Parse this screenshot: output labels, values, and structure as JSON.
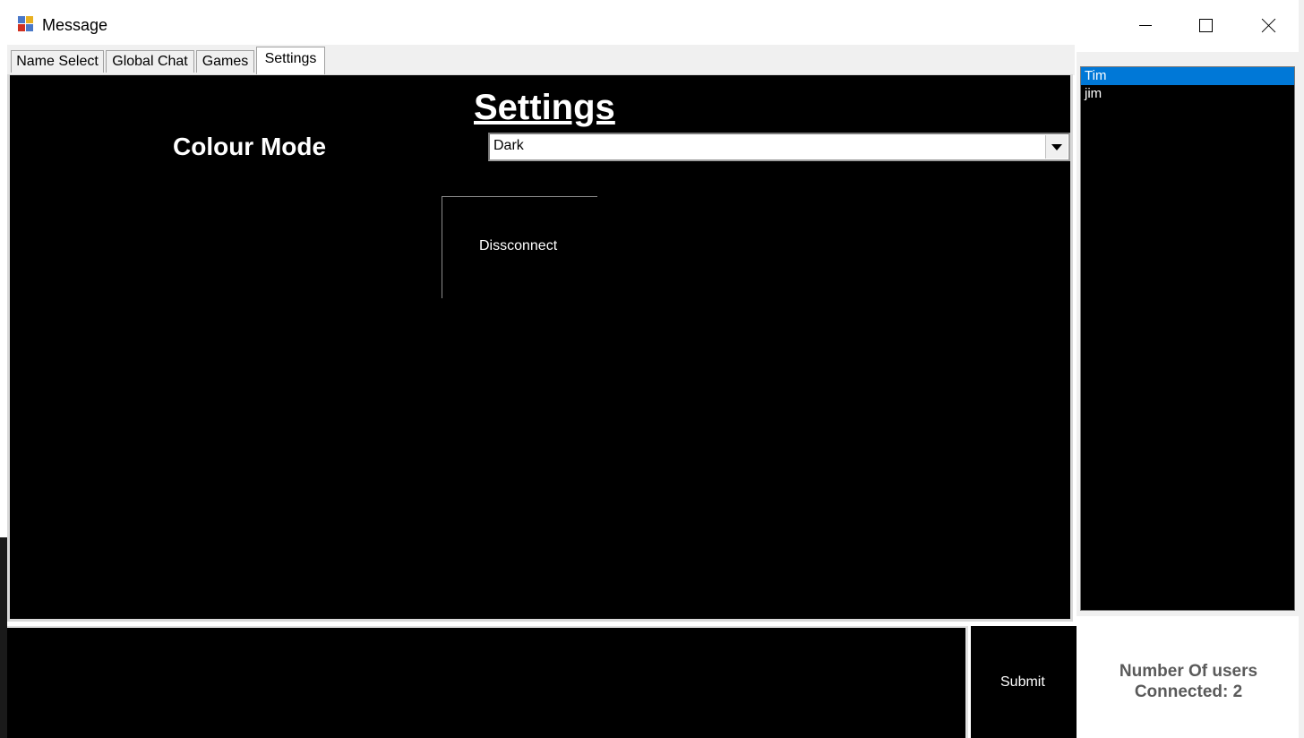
{
  "window": {
    "title": "Message",
    "minimize_icon": "minimize-icon",
    "maximize_icon": "maximize-icon",
    "close_icon": "close-icon"
  },
  "tabs": [
    {
      "label": "Name Select",
      "active": false
    },
    {
      "label": "Global Chat",
      "active": false
    },
    {
      "label": "Games",
      "active": false
    },
    {
      "label": "Settings",
      "active": true
    }
  ],
  "settings": {
    "heading": "Settings",
    "colour_mode_label": "Colour Mode",
    "colour_mode_value": "Dark",
    "disconnect_label": "Dissconnect"
  },
  "composer": {
    "message_value": "",
    "submit_label": "Submit"
  },
  "users": {
    "items": [
      {
        "name": "Tim",
        "selected": true
      },
      {
        "name": "jim",
        "selected": false
      }
    ],
    "count_line1": "Number Of users",
    "count_line2": "Connected: 2"
  },
  "colors": {
    "panel_bg": "#000000",
    "selection": "#0078d7",
    "count_text": "#5a5a5a"
  }
}
